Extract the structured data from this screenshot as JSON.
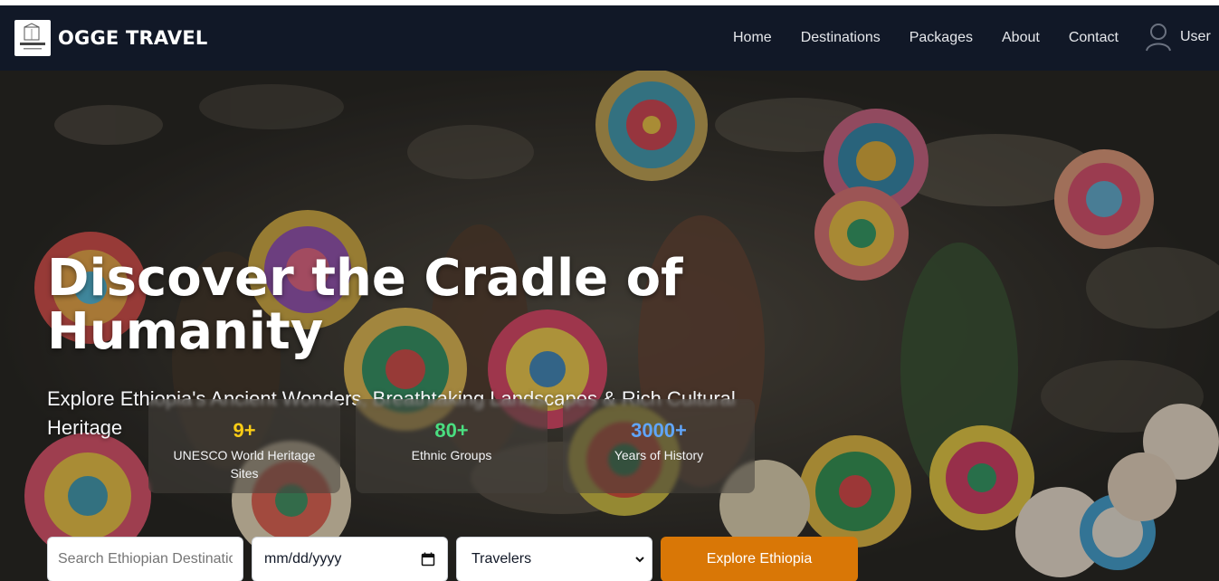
{
  "brand": {
    "name": "OGGE TRAVEL",
    "logo_text": "OGGE TRAVEL"
  },
  "nav": {
    "links": [
      "Home",
      "Destinations",
      "Packages",
      "About",
      "Contact"
    ],
    "user_label": "User"
  },
  "hero": {
    "title": "Discover the Cradle of Humanity",
    "subtitle": "Explore Ethiopia's Ancient Wonders, Breathtaking Landscapes & Rich Cultural Heritage"
  },
  "stats": [
    {
      "value": "9+",
      "label": "UNESCO World Heritage Sites",
      "color": "#facc15"
    },
    {
      "value": "80+",
      "label": "Ethnic Groups",
      "color": "#4ade80"
    },
    {
      "value": "3000+",
      "label": "Years of History",
      "color": "#60a5fa"
    }
  ],
  "search": {
    "destination_placeholder": "Search Ethiopian Destinatio",
    "date_placeholder": "mm/dd/yyyy",
    "travelers_selected": "Travelers",
    "explore_label": "Explore Ethiopia"
  },
  "colors": {
    "navbar": "#111827",
    "accent": "#d97706"
  }
}
